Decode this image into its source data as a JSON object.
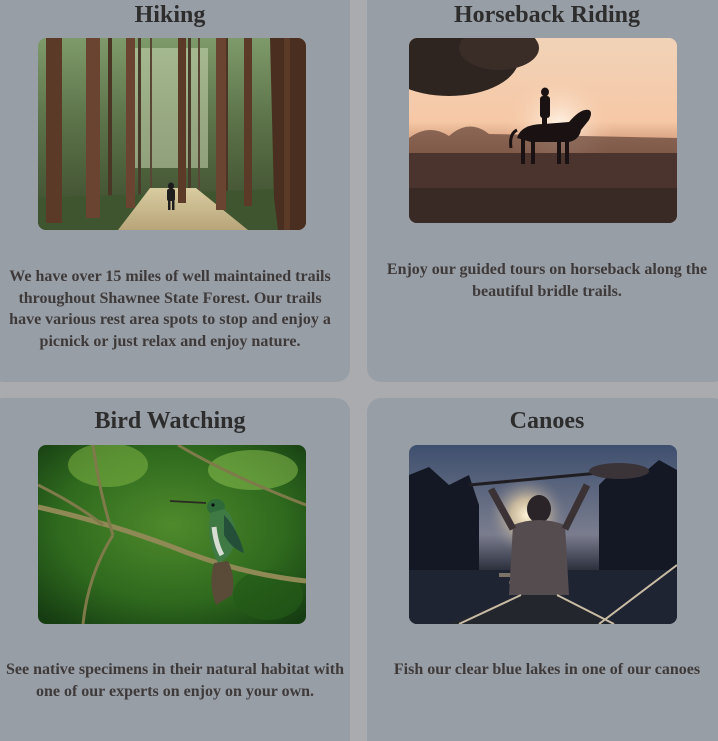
{
  "activities": [
    {
      "title": "Hiking",
      "image": "forest-trail-hiker-photo",
      "description": "We have over 15 miles of well maintained trails throughout Shawnee State Forest. Our trails have various rest area spots to stop and enjoy a picnick or just relax and enjoy nature."
    },
    {
      "title": "Horseback Riding",
      "image": "horse-rider-sunset-photo",
      "description": "Enjoy our guided tours on horseback along the beautiful bridle trails."
    },
    {
      "title": "Bird Watching",
      "image": "hummingbird-on-branch-photo",
      "description": "See native specimens in their natural habitat with one of our experts on enjoy on your own."
    },
    {
      "title": "Canoes",
      "image": "canoe-paddler-sunset-photo",
      "description": "Fish our clear blue lakes in one of our canoes"
    }
  ],
  "colors": {
    "page_background": "#a9abae",
    "card_background": "#989ea6",
    "heading_text": "#2d2d2d",
    "body_text": "#3e3a3a"
  }
}
